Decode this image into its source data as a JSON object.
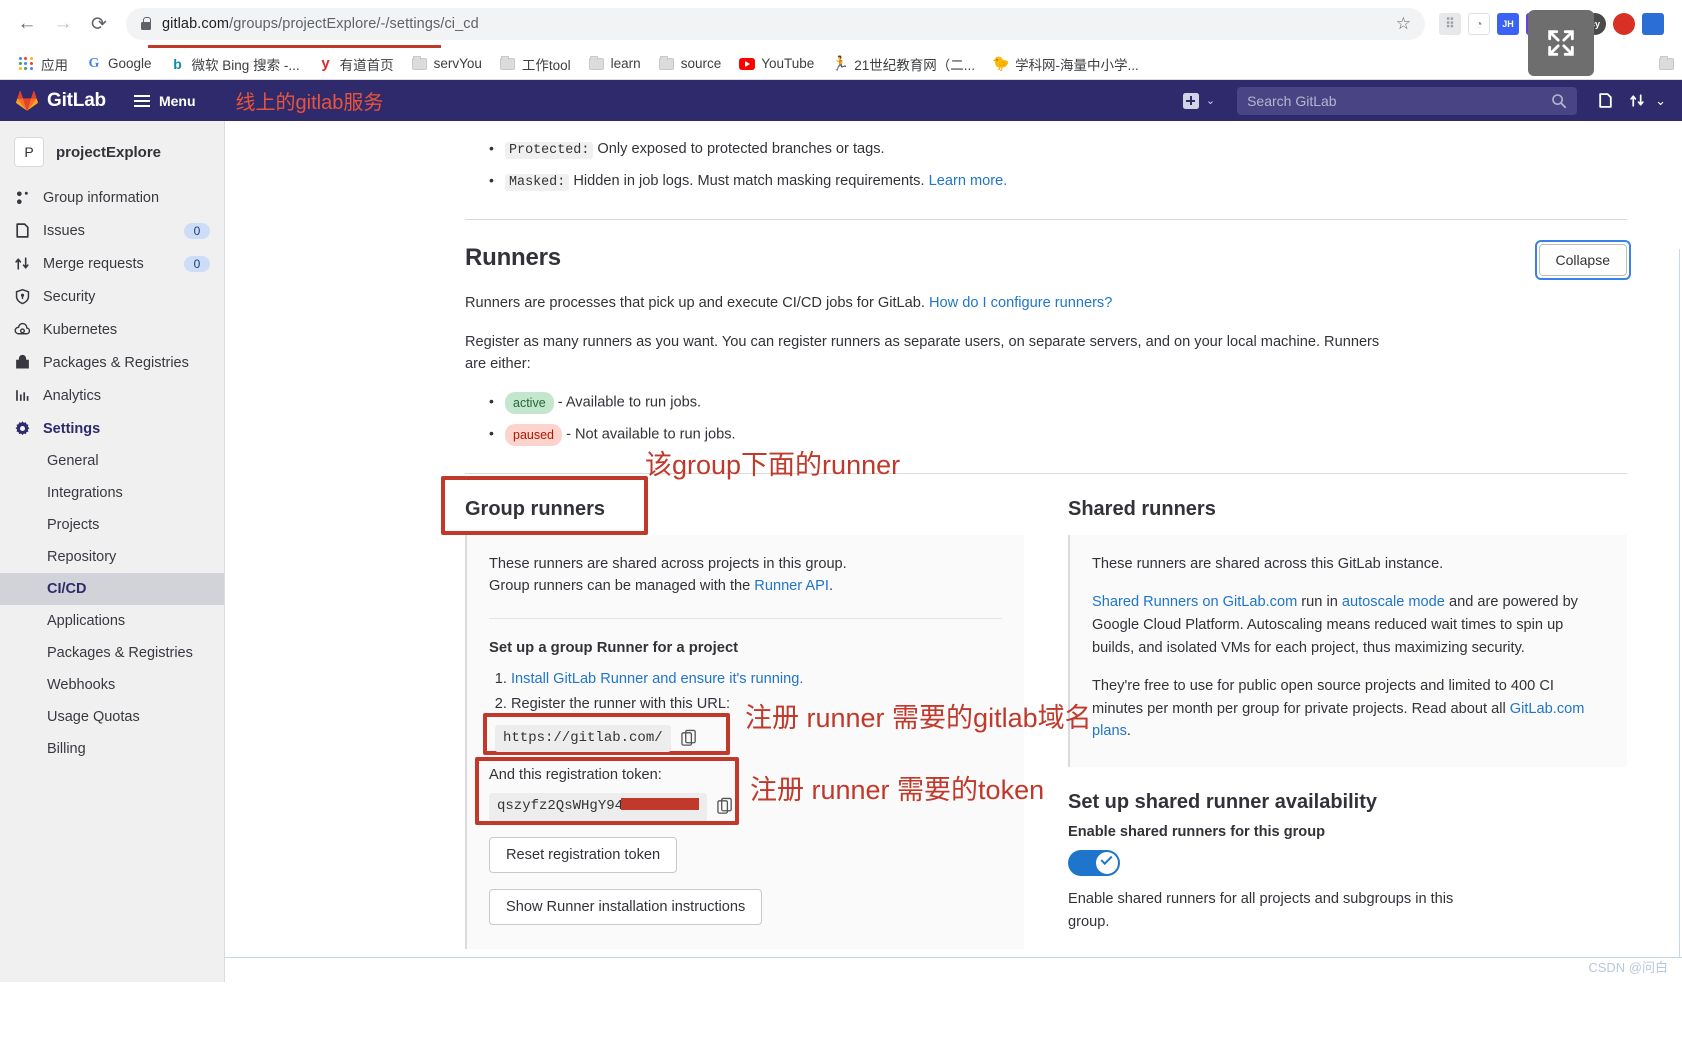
{
  "browser": {
    "back_icon": "back-arrow-icon",
    "forward_icon": "forward-arrow-icon",
    "reload_icon": "reload-icon",
    "url_domain": "gitlab.com",
    "url_path": "/groups/projectExplore/-/settings/ci_cd",
    "star_glyph": "☆",
    "extensions": [
      "",
      "",
      "JH",
      "RP",
      "",
      "cy",
      "",
      ""
    ],
    "bookmarks": [
      {
        "label": "应用",
        "icon": "apps-grid-icon"
      },
      {
        "label": "Google",
        "icon": "google-icon"
      },
      {
        "label": "微软 Bing 搜索 -...",
        "icon": "bing-icon"
      },
      {
        "label": "有道首页",
        "icon": "youdao-icon"
      },
      {
        "label": "servYou",
        "icon": "folder-icon"
      },
      {
        "label": "工作tool",
        "icon": "folder-icon"
      },
      {
        "label": "learn",
        "icon": "folder-icon"
      },
      {
        "label": "source",
        "icon": "folder-icon"
      },
      {
        "label": "YouTube",
        "icon": "youtube-icon"
      },
      {
        "label": "21世纪教育网（二...",
        "icon": "site-icon"
      },
      {
        "label": "学科网-海量中小学...",
        "icon": "site-icon"
      }
    ]
  },
  "gitlab_nav": {
    "brand": "GitLab",
    "menu_label": "Menu",
    "annotation": "线上的gitlab服务",
    "create_icon": "plus-square-icon",
    "create_chevron": "⌄",
    "search_placeholder": "Search GitLab",
    "search_icon": "search-icon",
    "issues_icon": "issues-icon",
    "merge_icon": "merge-request-icon",
    "merge_chevron": "⌄"
  },
  "sidebar": {
    "project_initial": "P",
    "project_name": "projectExplore",
    "items": [
      {
        "label": "Group information",
        "icon": "group-information-icon",
        "badge": null
      },
      {
        "label": "Issues",
        "icon": "issues-icon",
        "badge": "0"
      },
      {
        "label": "Merge requests",
        "icon": "merge-request-icon",
        "badge": "0"
      },
      {
        "label": "Security",
        "icon": "shield-icon",
        "badge": null
      },
      {
        "label": "Kubernetes",
        "icon": "kubernetes-icon",
        "badge": null
      },
      {
        "label": "Packages & Registries",
        "icon": "package-icon",
        "badge": null
      },
      {
        "label": "Analytics",
        "icon": "analytics-icon",
        "badge": null
      },
      {
        "label": "Settings",
        "icon": "gear-icon",
        "badge": null,
        "active": true
      }
    ],
    "sub_items": [
      {
        "label": "General"
      },
      {
        "label": "Integrations"
      },
      {
        "label": "Projects"
      },
      {
        "label": "Repository"
      },
      {
        "label": "CI/CD",
        "selected": true
      },
      {
        "label": "Applications"
      },
      {
        "label": "Packages & Registries"
      },
      {
        "label": "Webhooks"
      },
      {
        "label": "Usage Quotas"
      },
      {
        "label": "Billing"
      }
    ]
  },
  "main": {
    "variable_bullets": [
      {
        "code": "Protected:",
        "text": "Only exposed to protected branches or tags.",
        "link": null
      },
      {
        "code": "Masked:",
        "text": "Hidden in job logs. Must match masking requirements.",
        "link": "Learn more."
      }
    ],
    "runners_title": "Runners",
    "collapse_label": "Collapse",
    "runners_desc": "Runners are processes that pick up and execute CI/CD jobs for GitLab.",
    "runners_desc_link": "How do I configure runners?",
    "register_desc": "Register as many runners as you want. You can register runners as separate users, on separate servers, and on your local machine. Runners are either:",
    "state_bullets": [
      {
        "pill": "active",
        "pill_class": "active",
        "text": "- Available to run jobs."
      },
      {
        "pill": "paused",
        "pill_class": "paused",
        "text": "- Not available to run jobs."
      }
    ],
    "group_runners": {
      "title": "Group runners",
      "annotation": "该group下面的runner",
      "desc_line1": "These runners are shared across projects in this group.",
      "desc_line2": "Group runners can be managed with the",
      "desc_link": "Runner API",
      "setup_heading": "Set up a group Runner for a project",
      "step1_link": "Install GitLab Runner and ensure it's running.",
      "step2_text": "Register the runner with this URL:",
      "url_value": "https://gitlab.com/",
      "token_label": "And this registration token:",
      "token_value": "qszyfz2QsWHgY94",
      "copy_icon": "copy-to-clipboard-icon",
      "reset_button": "Reset registration token",
      "instructions_button": "Show Runner installation instructions"
    },
    "shared_runners": {
      "title": "Shared runners",
      "desc1": "These runners are shared across this GitLab instance.",
      "p2_link1": "Shared Runners on GitLab.com",
      "p2_mid": " run in ",
      "p2_link2": "autoscale mode",
      "p2_rest": " and are powered by Google Cloud Platform. Autoscaling means reduced wait times to spin up builds, and isolated VMs for each project, thus maximizing security.",
      "p3_start": "They're free to use for public open source projects and limited to 400 CI minutes per month per group for private projects. Read about all ",
      "p3_link": "GitLab.com plans",
      "p3_end": ".",
      "availability_heading": "Set up shared runner availability",
      "enable_label": "Enable shared runners for this group",
      "toggle_state": "on",
      "enable_desc": "Enable shared runners for all projects and subgroups in this group."
    },
    "annotations": {
      "domain_note": "注册 runner 需要的gitlab域名",
      "token_note": "注册 runner 需要的token"
    }
  },
  "watermark": "CSDN @问白"
}
